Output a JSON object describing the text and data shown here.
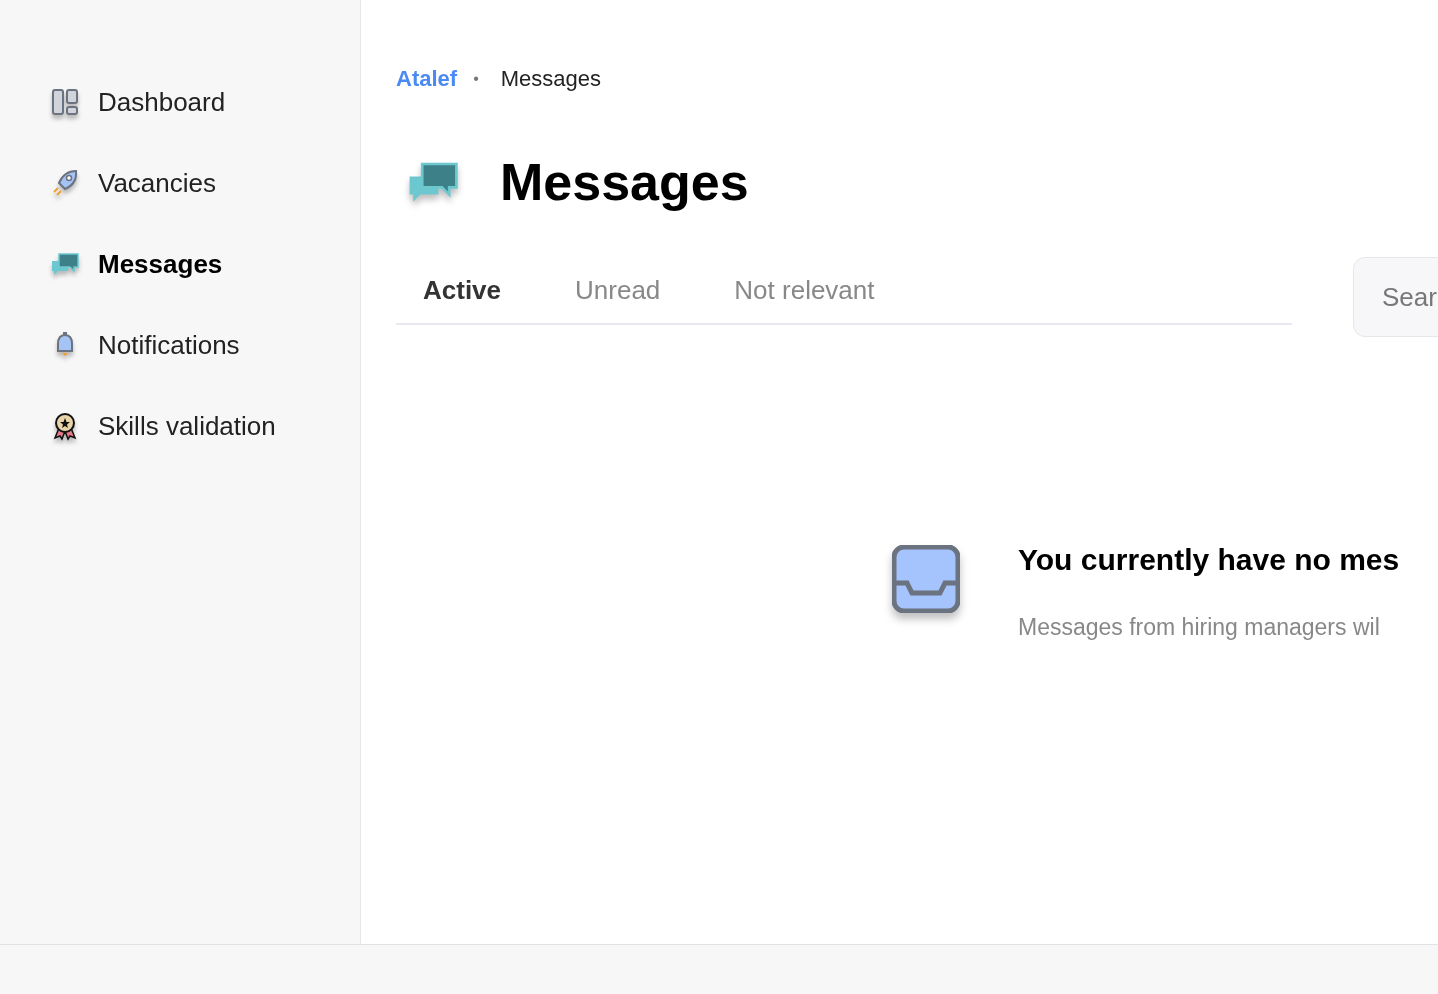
{
  "sidebar": {
    "items": [
      {
        "label": "Dashboard",
        "selected": false
      },
      {
        "label": "Vacancies",
        "selected": false
      },
      {
        "label": "Messages",
        "selected": true
      },
      {
        "label": "Notifications",
        "selected": false
      },
      {
        "label": "Skills validation",
        "selected": false
      }
    ]
  },
  "breadcrumb": {
    "link": "Atalef",
    "separator": "•",
    "current": "Messages"
  },
  "page_title": "Messages",
  "tabs": [
    {
      "label": "Active",
      "selected": true
    },
    {
      "label": "Unread",
      "selected": false
    },
    {
      "label": "Not relevant",
      "selected": false
    }
  ],
  "search": {
    "placeholder": "Sear"
  },
  "empty_state": {
    "title": "You currently have no mes",
    "text": "Messages from hiring managers wil"
  }
}
